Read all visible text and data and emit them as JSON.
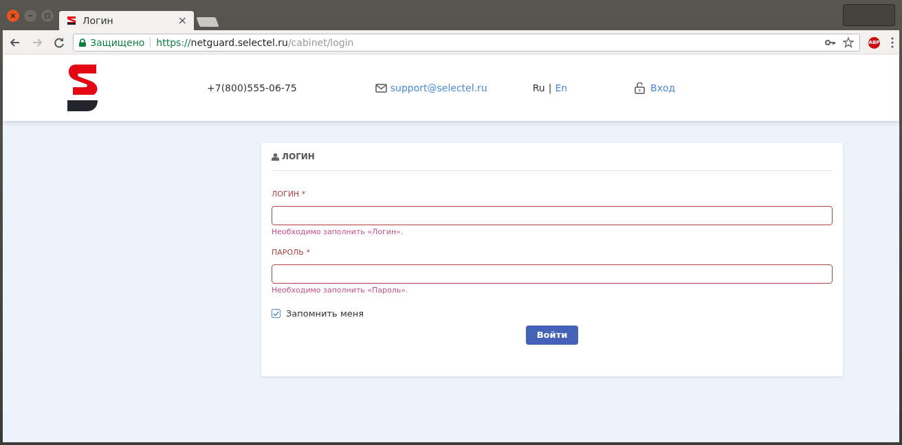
{
  "browser": {
    "tab": {
      "title": "Логин",
      "close": "×"
    },
    "address_bar": {
      "security": "Защищено",
      "scheme": "https://",
      "host": "netguard.selectel.ru",
      "path": "/cabinet/login"
    },
    "extension_badge": "ABP"
  },
  "header": {
    "phone": "+7(800)555-06-75",
    "email": "support@selectel.ru",
    "languages": [
      {
        "label": "Ru",
        "selected": true
      },
      {
        "label": "En",
        "selected": false
      }
    ],
    "separator": "|",
    "login_link": "Вход"
  },
  "form": {
    "title": "ЛОГИН",
    "fields": [
      {
        "label": "ЛОГИН *",
        "error": "Необходимо заполнить «Логин».",
        "invalid": true
      },
      {
        "label": "ПАРОЛЬ *",
        "error": "Необходимо заполнить «Пароль».",
        "invalid": true
      }
    ],
    "remember": {
      "label": "Запомнить меня",
      "checked": true
    },
    "submit": "Войти"
  }
}
